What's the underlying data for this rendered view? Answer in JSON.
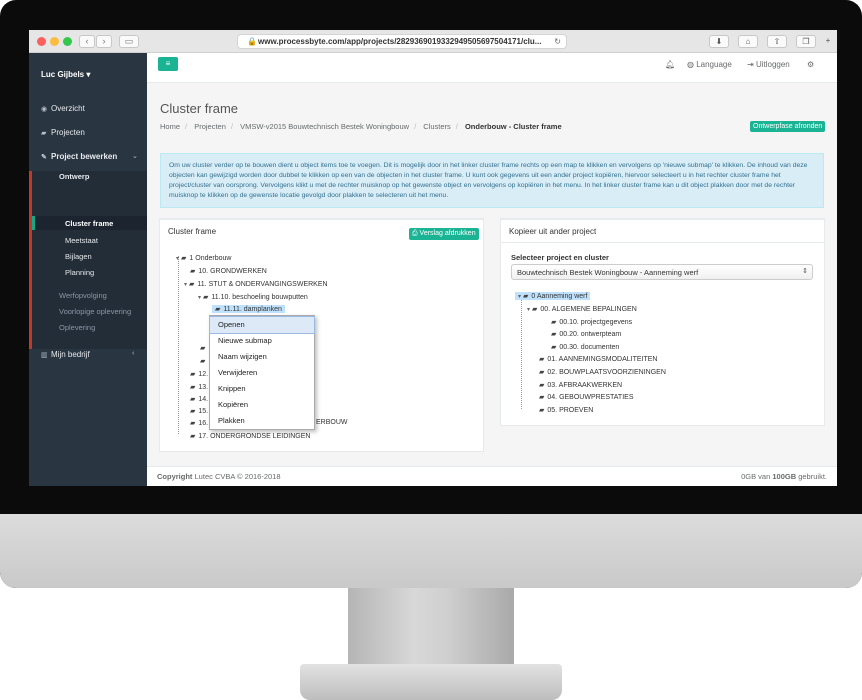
{
  "browser": {
    "url": "www.processbyte.com/app/projects/2829369019332949505697504171/clu...",
    "back_icon": "chevron-left",
    "forward_icon": "chevron-right"
  },
  "sidebar": {
    "user": "Luc Gijbels ▾",
    "items": [
      {
        "label": "Overzicht",
        "icon": "dashboard"
      },
      {
        "label": "Projecten",
        "icon": "folder"
      },
      {
        "label": "Project bewerken",
        "icon": "pencil"
      },
      {
        "label": "Mijn bedrijf",
        "icon": "building"
      }
    ],
    "sub": [
      {
        "label": "Ontwerp"
      },
      {
        "label": "Cluster frame"
      },
      {
        "label": "Meetstaat"
      },
      {
        "label": "Bijlagen"
      },
      {
        "label": "Planning"
      },
      {
        "label": "Werfopvolging"
      },
      {
        "label": "Voorlopige oplevering"
      },
      {
        "label": "Oplevering"
      }
    ]
  },
  "topbar": {
    "language": "Language",
    "logout": "Uitloggen"
  },
  "page": {
    "title": "Cluster frame",
    "breadcrumb": [
      "Home",
      "Projecten",
      "VMSW-v2015 Bouwtechnisch Bestek Woningbouw",
      "Clusters",
      "Onderbouw - Cluster frame"
    ],
    "finish_button": "Ontwerpfase afronden",
    "info": "Om uw cluster verder op te bouwen dient u object items toe te voegen. Dit is mogelijk door in het linker cluster frame rechts op een map te klikken en vervolgens op 'nieuwe submap' te klikken. De inhoud van deze objecten kan gewijzigd worden door dubbel te klikken op een van de objecten in het cluster frame. U kunt ook gegevens uit een ander project kopiëren, hiervoor selecteert u in het rechter cluster frame het project/cluster van oorsprong. Vervolgens klikt u met de rechter muisknop op het gewenste object en vervolgens op kopiëren in het menu. In het linker cluster frame kan u dit object plakken door met de rechter muisknop te klikken op de gewenste locatie gevolgd door plakken te selecteren uit het menu."
  },
  "left_panel": {
    "title": "Cluster frame",
    "print_button": "Verslag afdrukken",
    "tree": [
      "1 Onderbouw",
      "10. GRONDWERKEN",
      "11. STUT & ONDERVANGINGSWERKEN",
      "11.10. beschoeling bouwputten",
      "11.11. damplanken",
      "12.",
      "13.",
      "14.",
      "15.",
      "16.",
      "ERBOUW",
      "17. ONDERGRONDSE LEIDINGEN"
    ]
  },
  "context_menu": [
    "Openen",
    "Nieuwe submap",
    "Naam wijzigen",
    "Verwijderen",
    "Knippen",
    "Kopiëren",
    "Plakken"
  ],
  "right_panel": {
    "title": "Kopieer uit ander project",
    "select_label": "Selecteer project en cluster",
    "select_value": "Bouwtechnisch Bestek Woningbouw - Aanneming werf",
    "tree": [
      "0 Aanneming werf",
      "00. ALGEMENE BEPALINGEN",
      "00.10. projectgegevens",
      "00.20. ontwerpteam",
      "00.30. documenten",
      "01. AANNEMINGSMODALITEITEN",
      "02. BOUWPLAATSVOORZIENINGEN",
      "03. AFBRAAKWERKEN",
      "04. GEBOUWPRESTATIES",
      "05. PROEVEN"
    ]
  },
  "footer": {
    "copyright_bold": "Copyright",
    "copyright": "Lutec CVBA © 2016-2018",
    "usage_pre": "0GB van",
    "usage_bold": "100GB",
    "usage_post": "gebruikt."
  }
}
